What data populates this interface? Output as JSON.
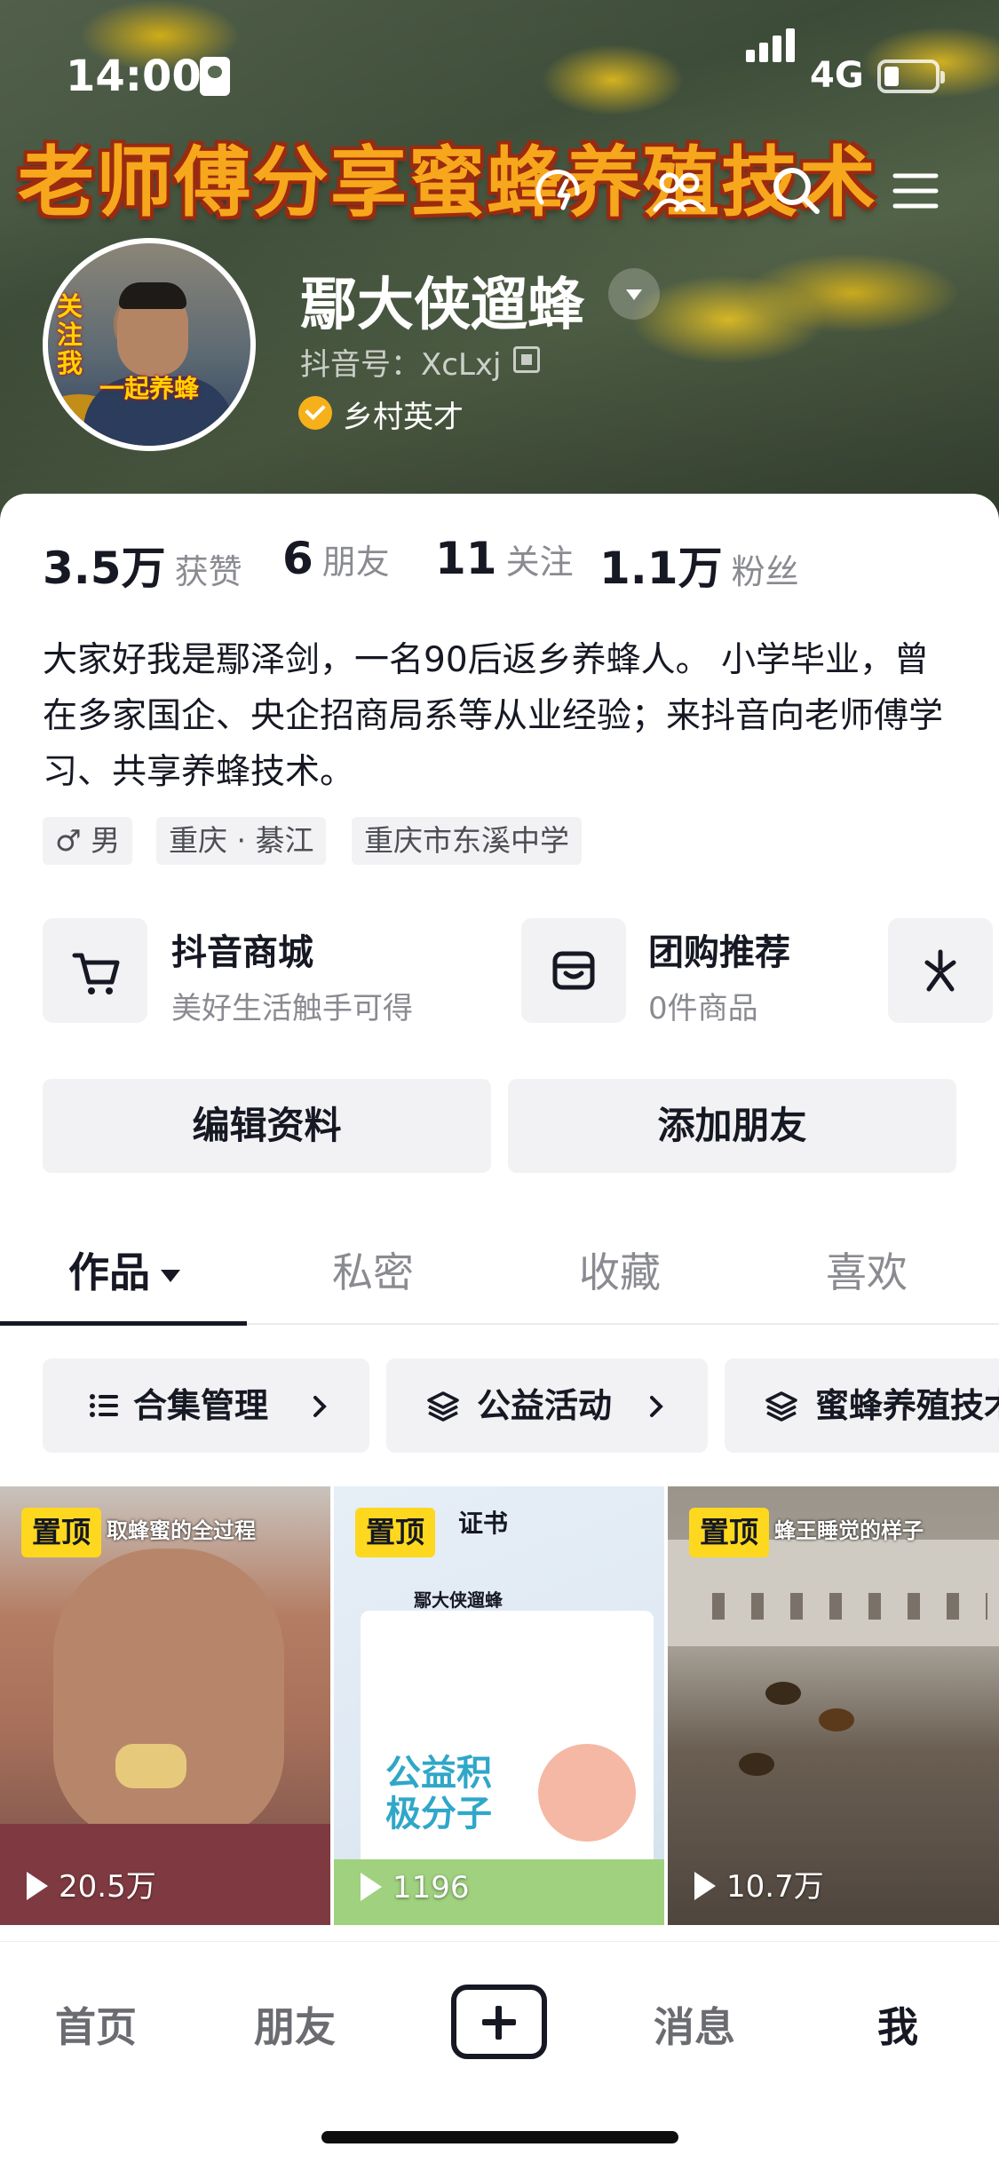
{
  "status_bar": {
    "time": "14:00",
    "network": "4G"
  },
  "header": {
    "banner_text": "老师傅分享蜜蜂养殖技术",
    "nickname": "鄢大侠遛蜂",
    "douyin_id": "抖音号：XcLxj",
    "verified_label": "乡村英才",
    "avatar_text_1": "关注我",
    "avatar_text_2": "一起养蜂"
  },
  "stats": [
    {
      "value": "3.5万",
      "label": "获赞"
    },
    {
      "value": "6",
      "label": "朋友"
    },
    {
      "value": "11",
      "label": "关注"
    },
    {
      "value": "1.1万",
      "label": "粉丝"
    }
  ],
  "bio": "大家好我是鄢泽剑，一名90后返乡养蜂人。 小学毕业，曾在多家国企、央企招商局系等从业经验；来抖音向老师傅学习、共享养蜂技术。",
  "tags": [
    "♂ 男",
    "重庆 · 綦江",
    "重庆市东溪中学"
  ],
  "services": [
    {
      "title": "抖音商城",
      "subtitle": "美好生活触手可得",
      "icon": "cart-icon"
    },
    {
      "title": "团购推荐",
      "subtitle": "0件商品",
      "icon": "store-icon"
    }
  ],
  "buttons": {
    "edit": "编辑资料",
    "add_friend": "添加朋友"
  },
  "tabs": [
    "作品",
    "私密",
    "收藏",
    "喜欢"
  ],
  "chips": [
    "合集管理",
    "公益活动",
    "蜜蜂养殖技术"
  ],
  "videos": [
    {
      "pin": "置顶",
      "views": "20.5万",
      "caption": "取蜂蜜的全过程"
    },
    {
      "pin": "置顶",
      "views": "1196",
      "caption": "证书",
      "card_title": "公益积极分子",
      "card_name": "鄢大侠遛蜂"
    },
    {
      "pin": "置顶",
      "views": "10.7万",
      "caption": "蜂王睡觉的样子"
    }
  ],
  "tabbar": [
    "首页",
    "朋友",
    "消息",
    "我"
  ],
  "colors": {
    "pin": "#fdd81e",
    "verified": "#f6b11a",
    "text": "#161823",
    "muted": "#8a8b91"
  }
}
